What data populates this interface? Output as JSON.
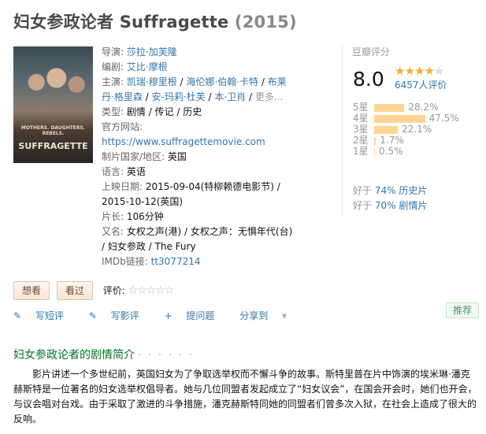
{
  "title": {
    "cn": "妇女参政论者",
    "en": "Suffragette",
    "year": "(2015)"
  },
  "poster": {
    "tagline": "MOTHERS. DAUGHTERS. REBELS.",
    "title_text": "SUFFRAGETTE"
  },
  "info": {
    "director_label": "导演:",
    "director": "莎拉·加芙隆",
    "writer_label": "编剧:",
    "writer": "艾比·摩根",
    "cast_label": "主演:",
    "cast_1": "凯瑞·穆里根",
    "cast_2": "海伦娜·伯翰·卡特",
    "cast_3": "布莱丹·格里森",
    "cast_4": "安-玛莉·杜芙",
    "cast_5": "本·卫肖",
    "cast_more": "更多...",
    "genre_label": "类型:",
    "genre": "剧情 / 传记 / 历史",
    "site_label": "官方网站:",
    "site": "https://www.suffragettemovie.com",
    "country_label": "制片国家/地区:",
    "country": "英国",
    "lang_label": "语言:",
    "lang": "英语",
    "release_label": "上映日期:",
    "release": "2015-09-04(特柳赖德电影节) / 2015-10-12(英国)",
    "runtime_label": "片长:",
    "runtime": "106分钟",
    "aka_label": "又名:",
    "aka": "女权之声(港) / 女权之声：无惧年代(台) / 妇女参政 / The Fury",
    "imdb_label": "IMDb链接:",
    "imdb": "tt3077214"
  },
  "rating": {
    "head": "豆瓣评分",
    "score": "8.0",
    "votes": "6457人评价",
    "stars_on": "★★★★",
    "stars_off": "★",
    "rows": [
      {
        "label": "5星",
        "pct": "28.2%",
        "w": 28.2
      },
      {
        "label": "4星",
        "pct": "47.5%",
        "w": 47.5
      },
      {
        "label": "3星",
        "pct": "22.1%",
        "w": 22.1
      },
      {
        "label": "2星",
        "pct": "1.7%",
        "w": 1.7
      },
      {
        "label": "1星",
        "pct": "0.5%",
        "w": 0.5
      }
    ],
    "better_1_pre": "好于",
    "better_1_link": "74% 历史片",
    "better_2_pre": "好于",
    "better_2_link": "70% 剧情片"
  },
  "actions": {
    "want": "想看",
    "seen": "看过",
    "rate_label": "评价:",
    "rate_stars": "☆☆☆☆☆"
  },
  "tools": {
    "short": "写短评",
    "review": "写影评",
    "ask": "提问题",
    "share": "分享到"
  },
  "recommend": "推荐",
  "summary": {
    "title": "妇女参政论者的剧情简介",
    "dots": "· · · · · ·",
    "text": "影片讲述一个多世纪前，英国妇女为了争取选举权而不懈斗争的故事。斯特里普在片中饰演的埃米琳·潘克赫斯特是一位著名的妇女选举权倡导者。她与几位同盟者发起成立了“妇女议会”，在国会开会时，她们也开会，与议会唱对台戏。由于采取了激进的斗争措施，潘克赫斯特同她的同盟者们曾多次入狱，在社会上造成了很大的反响。"
  }
}
